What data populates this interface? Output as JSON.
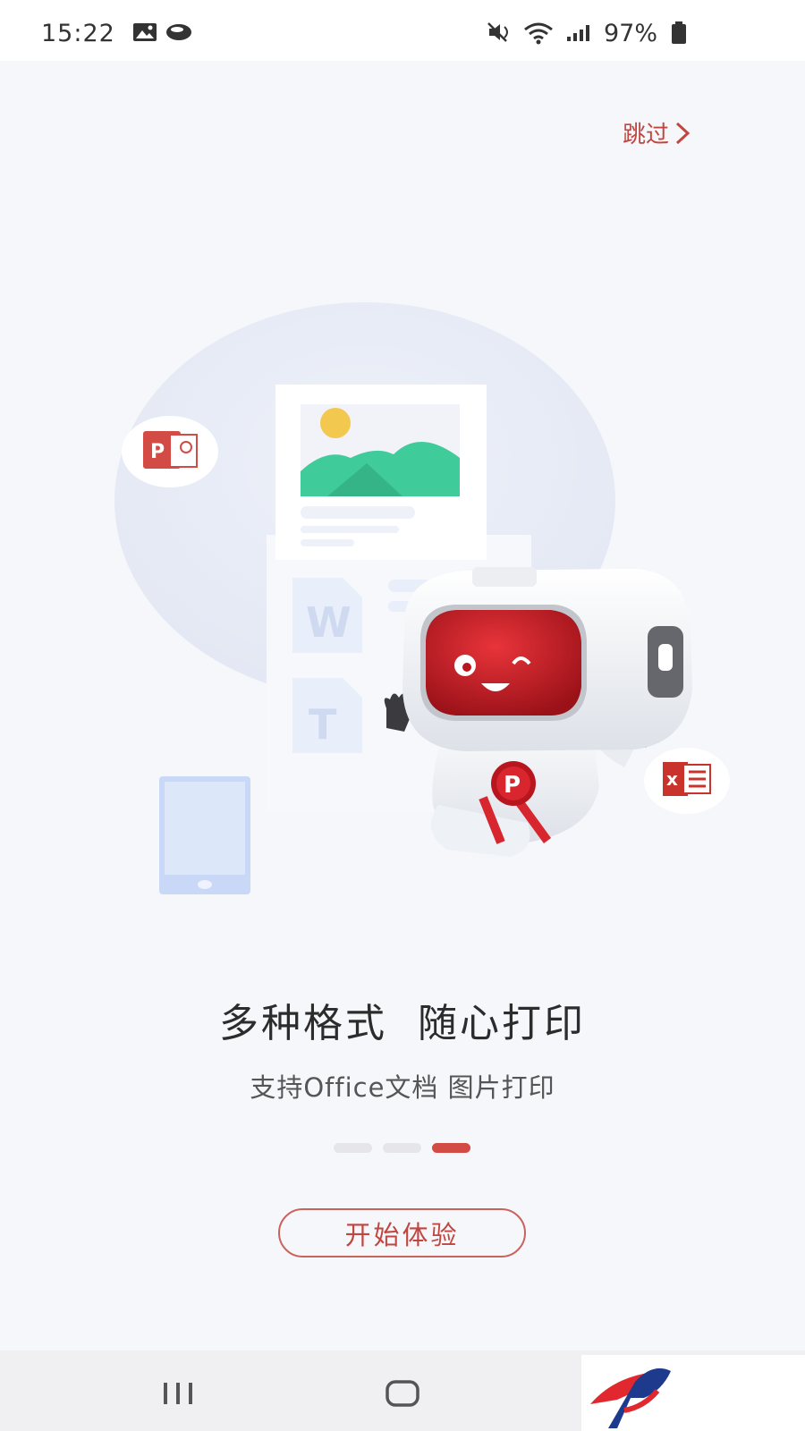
{
  "status_bar": {
    "time": "15:22",
    "battery": "97%",
    "icons": [
      "gallery-icon",
      "cloud-icon",
      "mute-icon",
      "wifi-icon",
      "signal-icon",
      "battery-icon"
    ]
  },
  "skip": {
    "label": "跳过"
  },
  "slide": {
    "headline": "多种格式  随心打印",
    "subline": "支持Office文档 图片打印"
  },
  "pager": {
    "count": 3,
    "active": 3
  },
  "start_button": {
    "label": "开始体验"
  },
  "colors": {
    "accent": "#d24b44",
    "background": "#f6f7fb",
    "robot_red": "#c8202a",
    "excel_red": "#c8342c",
    "illustration_green": "#3fcb9a"
  }
}
